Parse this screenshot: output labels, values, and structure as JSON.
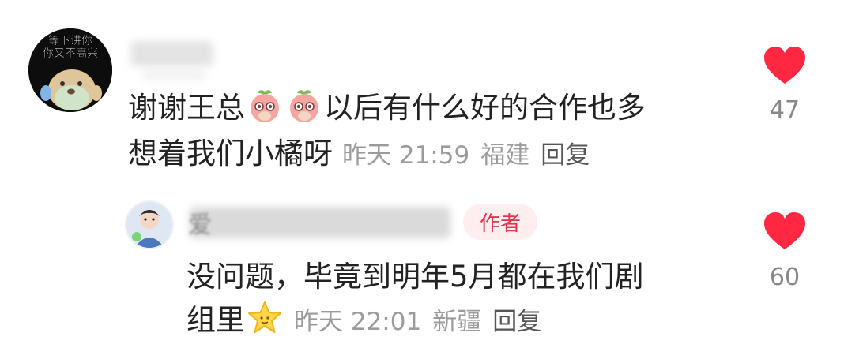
{
  "comments": [
    {
      "avatar_caption_line1": "等下讲你",
      "avatar_caption_line2": "你又不高兴",
      "text_line1_part1": "谢谢王总",
      "text_line1_part2": "以后有什么好的合作也多",
      "text_line2": "想着我们小橘呀",
      "time": "昨天 21:59",
      "location": "福建",
      "reply_label": "回复",
      "likes": "47"
    },
    {
      "name_partial": "爱",
      "badge": "作者",
      "text_line1": "没问题，毕竟到明年5月都在我们剧",
      "text_line2": "组里",
      "time": "昨天 22:01",
      "location": "新疆",
      "reply_label": "回复",
      "likes": "60"
    }
  ],
  "colors": {
    "like": "#ff2742",
    "badge_text": "#e3364d",
    "badge_bg": "#ffeef0",
    "meta": "#9b9b9b"
  },
  "icons": [
    "heart-icon",
    "peach-emoji",
    "star-emoji"
  ]
}
